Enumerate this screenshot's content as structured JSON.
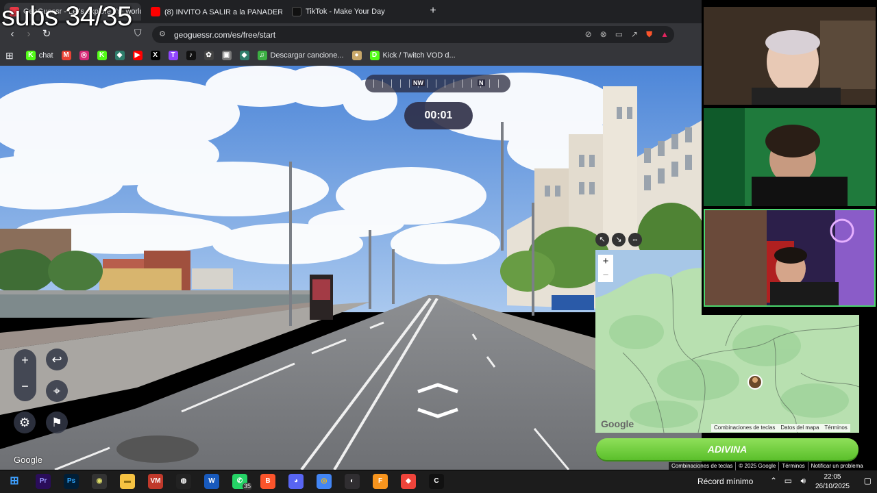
{
  "overlay": {
    "subs_text": "subs 34/35"
  },
  "tabs": [
    {
      "title": "GeoGuessr - Let's explore the world!",
      "favicon": "geoguessr-icon",
      "color": "#e63946"
    },
    {
      "title": "(8) INVITO A SALIR a la PANADERA😳",
      "favicon": "youtube-icon",
      "color": "#ff0000"
    },
    {
      "title": "TikTok - Make Your Day",
      "favicon": "tiktok-icon",
      "color": "#111111"
    }
  ],
  "newtab_label": "+",
  "address": {
    "url": "geoguessr.com/es/free/start"
  },
  "bookmarks": [
    {
      "label": "chat",
      "icon": "kick-icon",
      "color": "#53fc18",
      "glyph": "K"
    },
    {
      "label": "",
      "icon": "gmail-icon",
      "color": "#ea4335",
      "glyph": "M"
    },
    {
      "label": "",
      "icon": "instagram-icon",
      "color": "#d62976",
      "glyph": "◎"
    },
    {
      "label": "",
      "icon": "kick-icon",
      "color": "#53fc18",
      "glyph": "K"
    },
    {
      "label": "",
      "icon": "ethereum-icon",
      "color": "#2e7d6b",
      "glyph": "◆"
    },
    {
      "label": "",
      "icon": "youtube-icon",
      "color": "#ff0000",
      "glyph": "▶"
    },
    {
      "label": "",
      "icon": "x-icon",
      "color": "#000000",
      "glyph": "X"
    },
    {
      "label": "",
      "icon": "twitch-icon",
      "color": "#9146ff",
      "glyph": "T"
    },
    {
      "label": "",
      "icon": "tiktok-icon",
      "color": "#111111",
      "glyph": "♪"
    },
    {
      "label": "",
      "icon": "openai-icon",
      "color": "#444444",
      "glyph": "✿"
    },
    {
      "label": "",
      "icon": "minecraft-icon",
      "color": "#7a7a7a",
      "glyph": "▣"
    },
    {
      "label": "",
      "icon": "ethereum-icon",
      "color": "#2e7d6b",
      "glyph": "◆"
    },
    {
      "label": "Descargar cancione...",
      "icon": "download-icon",
      "color": "#3cb043",
      "glyph": "♫"
    },
    {
      "label": "",
      "icon": "bread-icon",
      "color": "#c9a86a",
      "glyph": "●"
    },
    {
      "label": "Kick / Twitch VOD d...",
      "icon": "kick-vod-icon",
      "color": "#53fc18",
      "glyph": "D"
    }
  ],
  "game": {
    "compass": {
      "left_dir": "NW",
      "right_dir": "N"
    },
    "timer": "00:01",
    "street_google": "Google",
    "guess_button": "ADIVINA"
  },
  "minimap": {
    "google": "Google",
    "footer": [
      "Combinaciones de teclas",
      "Datos del mapa",
      "Términos"
    ]
  },
  "page_footer": [
    "Combinaciones de teclas",
    "© 2025 Google",
    "Términos",
    "Notificar un problema"
  ],
  "taskbar": {
    "apps": [
      {
        "name": "premiere-icon",
        "glyph": "Pr",
        "color": "#2a0d5a",
        "fg": "#9999ff"
      },
      {
        "name": "photoshop-icon",
        "glyph": "Ps",
        "color": "#001e36",
        "fg": "#31a8ff"
      },
      {
        "name": "app-icon",
        "glyph": "◉",
        "color": "#333333",
        "fg": "#dddd66"
      },
      {
        "name": "folder-icon",
        "glyph": "▬",
        "color": "#f5c242",
        "fg": "#8a6a10"
      },
      {
        "name": "voicemeeter-icon",
        "glyph": "VM",
        "color": "#c0392b",
        "fg": "#ffffff"
      },
      {
        "name": "obs-icon",
        "glyph": "◍",
        "color": "#222222",
        "fg": "#ffffff"
      },
      {
        "name": "word-icon",
        "glyph": "W",
        "color": "#185abd",
        "fg": "#ffffff"
      },
      {
        "name": "whatsapp-icon",
        "glyph": "✆",
        "color": "#25d366",
        "fg": "#ffffff"
      },
      {
        "name": "brave-icon",
        "glyph": "B",
        "color": "#fb542b",
        "fg": "#ffffff"
      },
      {
        "name": "discord-icon",
        "glyph": "◕",
        "color": "#5865f2",
        "fg": "#ffffff"
      },
      {
        "name": "chrome-icon",
        "glyph": "◎",
        "color": "#4285f4",
        "fg": "#fbbc05"
      },
      {
        "name": "obs-studio-icon",
        "glyph": "◐",
        "color": "#302e31",
        "fg": "#ffffff"
      },
      {
        "name": "fl-studio-icon",
        "glyph": "F",
        "color": "#f7941d",
        "fg": "#ffffff"
      },
      {
        "name": "anydesk-icon",
        "glyph": "◆",
        "color": "#ef443b",
        "fg": "#ffffff"
      },
      {
        "name": "capcut-icon",
        "glyph": "C",
        "color": "#111111",
        "fg": "#ffffff"
      }
    ],
    "whatsapp_badge": "35",
    "weather": "Récord mínimo",
    "time": "22:05",
    "date": "26/10/2025"
  },
  "colors": {
    "guess_green": "#6fcf3a",
    "map_land": "#b8e0b0",
    "map_water": "#a7c7e7"
  }
}
